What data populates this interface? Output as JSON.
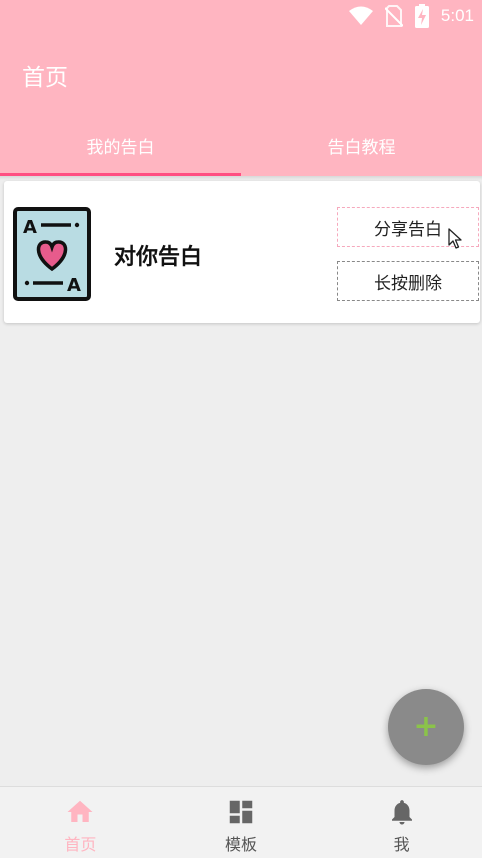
{
  "status_bar": {
    "time": "5:01",
    "icons": [
      "wifi-icon",
      "no-sim-icon",
      "battery-charging-icon"
    ]
  },
  "app_bar": {
    "title": "首页"
  },
  "tabs": [
    {
      "label": "我的告白",
      "active": true
    },
    {
      "label": "告白教程",
      "active": false
    }
  ],
  "card": {
    "title": "对你告白",
    "thumbnail_icon": "ace-of-hearts-card-icon",
    "share_label": "分享告白",
    "delete_label": "长按删除"
  },
  "fab": {
    "icon": "plus-icon",
    "label": "+"
  },
  "bottom_nav": [
    {
      "label": "首页",
      "icon": "home-icon",
      "active": true
    },
    {
      "label": "模板",
      "icon": "dashboard-icon",
      "active": false
    },
    {
      "label": "我",
      "icon": "bell-icon",
      "active": false
    }
  ],
  "colors": {
    "primary": "#ffb5c1",
    "tab_indicator": "#ff4f82",
    "fab": "#8a8a8a",
    "fab_icon": "#8bc34a"
  }
}
